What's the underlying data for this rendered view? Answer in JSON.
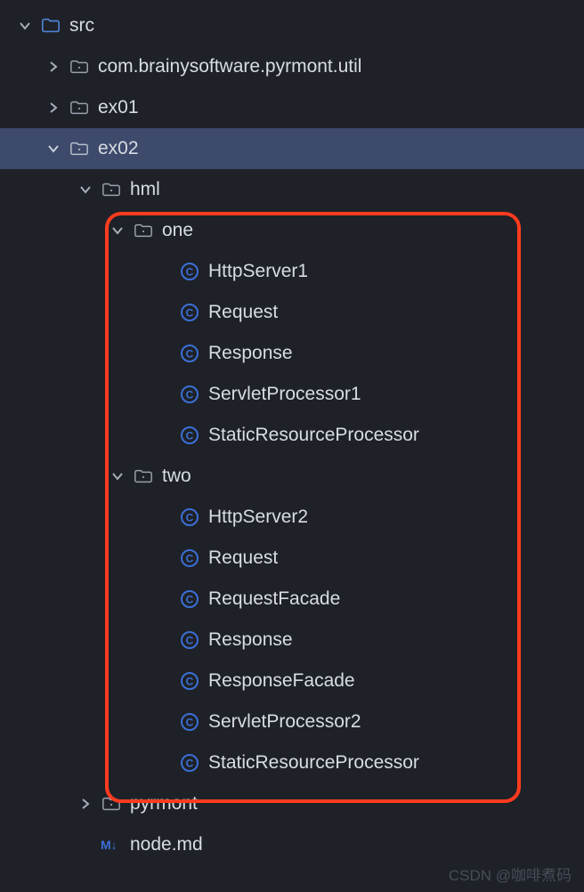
{
  "tree": {
    "src": "src",
    "pkg_util": "com.brainysoftware.pyrmont.util",
    "ex01": "ex01",
    "ex02": "ex02",
    "hml": "hml",
    "one": "one",
    "one_files": {
      "HttpServer1": "HttpServer1",
      "Request": "Request",
      "Response": "Response",
      "ServletProcessor1": "ServletProcessor1",
      "StaticResourceProcessor": "StaticResourceProcessor"
    },
    "two": "two",
    "two_files": {
      "HttpServer2": "HttpServer2",
      "Request": "Request",
      "RequestFacade": "RequestFacade",
      "Response": "Response",
      "ResponseFacade": "ResponseFacade",
      "ServletProcessor2": "ServletProcessor2",
      "StaticResourceProcessor": "StaticResourceProcessor"
    },
    "pyrmont": "pyrmont",
    "node_md": "node.md"
  },
  "watermark": "CSDN @咖啡煮码"
}
